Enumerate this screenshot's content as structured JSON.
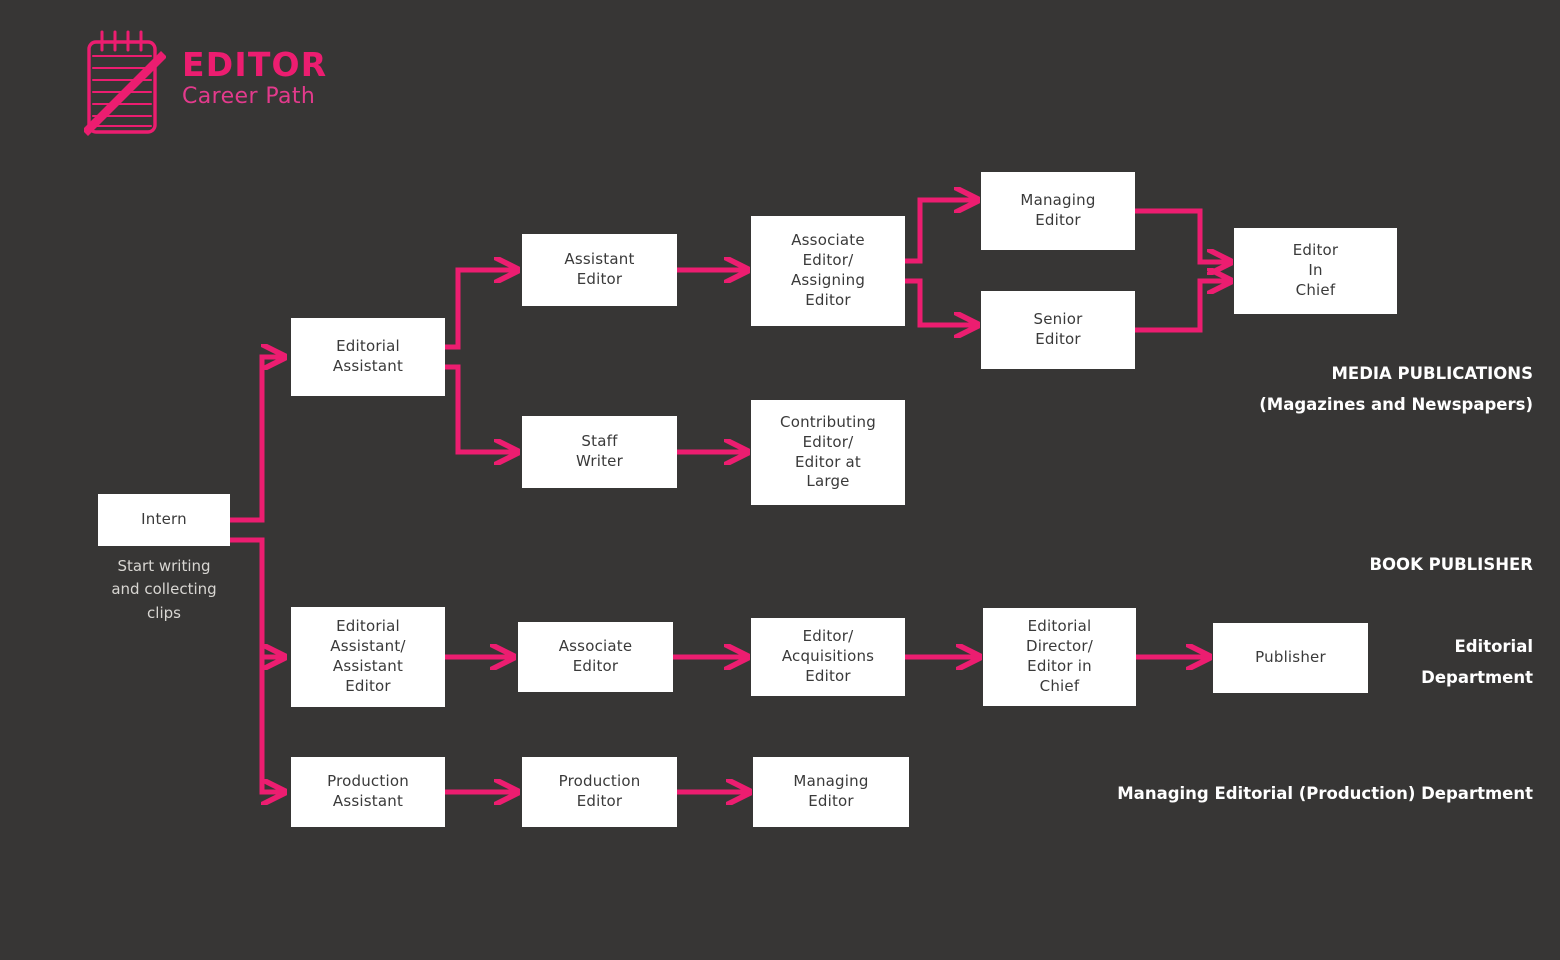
{
  "page": {
    "title": "Editor Career Path",
    "background_color": "#373635",
    "accent_color": "#EC1D70",
    "node_fill": "#FFFFFF",
    "node_text_color": "#3A3A3A",
    "label_color": "#FFFFFF"
  },
  "logo": {
    "icon": "notepad-with-pencil-icon",
    "title": "EDITOR",
    "subtitle": "Career Path"
  },
  "nodes": {
    "intern": "Intern",
    "editorial_assistant": "Editorial\nAssistant",
    "assistant_editor": "Assistant\nEditor",
    "associate_assigning_editor": "Associate\nEditor/\nAssigning\nEditor",
    "managing_editor_media": "Managing\nEditor",
    "senior_editor": "Senior\nEditor",
    "editor_in_chief": "Editor\nIn\nChief",
    "staff_writer": "Staff\nWriter",
    "contributing_editor": "Contributing\nEditor/\nEditor at\nLarge",
    "editorial_assistant_assistant_editor": "Editorial\nAssistant/\nAssistant\nEditor",
    "associate_editor_book": "Associate\nEditor",
    "editor_acquisitions_editor": "Editor/\nAcquisitions\nEditor",
    "editorial_director_editor_in_chief": "Editorial\nDirector/\nEditor in\nChief",
    "publisher": "Publisher",
    "production_assistant": "Production\nAssistant",
    "production_editor": "Production\nEditor",
    "managing_editor_production": "Managing\nEditor"
  },
  "captions": {
    "intern_note": "Start writing\nand collecting\nclips"
  },
  "section_labels": {
    "media_publications": "MEDIA PUBLICATIONS\n(Magazines and Newspapers)",
    "book_publisher": "BOOK PUBLISHER",
    "editorial_department": "Editorial\nDepartment",
    "managing_editorial_department": "Managing Editorial (Production) Department"
  },
  "chart_data": {
    "type": "diagram",
    "title": "Editor Career Path",
    "tracks": [
      {
        "name": "MEDIA PUBLICATIONS (Magazines and Newspapers)",
        "stages": [
          "Intern",
          "Editorial Assistant",
          "Assistant Editor",
          "Associate Editor/Assigning Editor",
          "Managing Editor",
          "Senior Editor",
          "Editor In Chief",
          "Staff Writer",
          "Contributing Editor/Editor at Large"
        ]
      },
      {
        "name": "BOOK PUBLISHER — Editorial Department",
        "stages": [
          "Intern",
          "Editorial Assistant/Assistant Editor",
          "Associate Editor",
          "Editor/Acquisitions Editor",
          "Editorial Director/Editor in Chief",
          "Publisher"
        ]
      },
      {
        "name": "BOOK PUBLISHER — Managing Editorial (Production) Department",
        "stages": [
          "Intern",
          "Production Assistant",
          "Production Editor",
          "Managing Editor"
        ]
      }
    ],
    "edges": [
      [
        "Intern",
        "Editorial Assistant"
      ],
      [
        "Editorial Assistant",
        "Assistant Editor"
      ],
      [
        "Editorial Assistant",
        "Staff Writer"
      ],
      [
        "Assistant Editor",
        "Associate Editor/Assigning Editor"
      ],
      [
        "Associate Editor/Assigning Editor",
        "Managing Editor"
      ],
      [
        "Associate Editor/Assigning Editor",
        "Senior Editor"
      ],
      [
        "Managing Editor",
        "Editor In Chief"
      ],
      [
        "Senior Editor",
        "Editor In Chief"
      ],
      [
        "Staff Writer",
        "Contributing Editor/Editor at Large"
      ],
      [
        "Intern",
        "Editorial Assistant/Assistant Editor"
      ],
      [
        "Editorial Assistant/Assistant Editor",
        "Associate Editor"
      ],
      [
        "Associate Editor",
        "Editor/Acquisitions Editor"
      ],
      [
        "Editor/Acquisitions Editor",
        "Editorial Director/Editor in Chief"
      ],
      [
        "Editorial Director/Editor in Chief",
        "Publisher"
      ],
      [
        "Intern",
        "Production Assistant"
      ],
      [
        "Production Assistant",
        "Production Editor"
      ],
      [
        "Production Editor",
        "Managing Editor"
      ]
    ]
  }
}
